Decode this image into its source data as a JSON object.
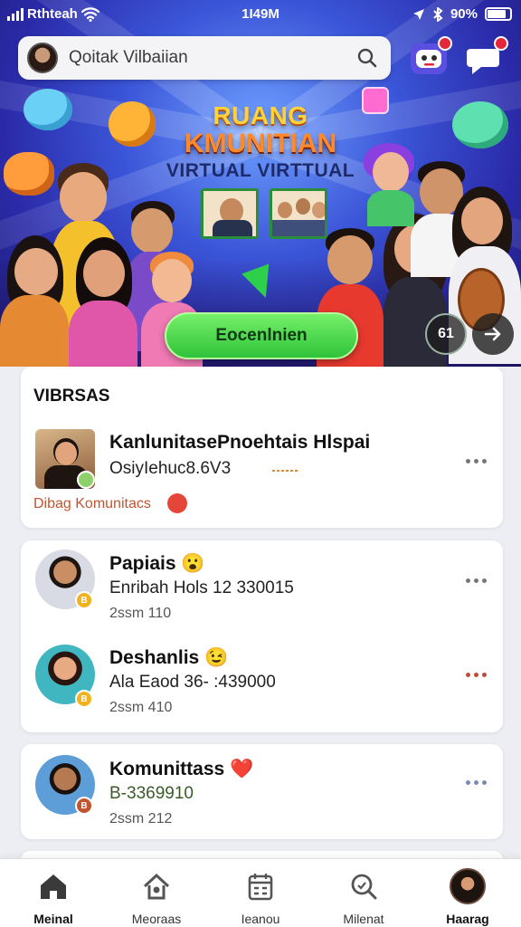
{
  "status_bar": {
    "carrier": "Rthteah",
    "time": "1I49M",
    "battery": "90%"
  },
  "header": {
    "search": {
      "value": "Qoitak Vilbaiian",
      "icon": "search-icon"
    },
    "chat_bot_icon": "chatbot-icon",
    "chat_icon": "chat-bubble-icon"
  },
  "hero": {
    "title_line1": "RUANG",
    "title_line2": "KMUNITIAN",
    "title_line3": "VIRTUAL VIRTTUAL",
    "cta_label": "Eocenlnien",
    "badge_label": "61",
    "arrow_icon": "arrow-right-icon"
  },
  "feed": {
    "section_title": "VIBRSAS",
    "featured": {
      "name": "KanlunitasePnoehtais Hlspai",
      "subtitle": "OsiyIehuc8.6V3",
      "tag": "Dibag Komunitacs"
    },
    "people": [
      {
        "name": "Papiais",
        "emoji": "😮",
        "line2": "Enribah Hols 12 330015",
        "line3": "2ssm 110",
        "badge": "B"
      },
      {
        "name": "Deshanlis",
        "emoji": "😉",
        "line2": "Ala Eaod 36- :439000",
        "line3": "2ssm 410",
        "badge": "B"
      },
      {
        "name": "Komunittass",
        "emoji": "❤️",
        "line2": "B-3369910",
        "line3": "2ssm 212",
        "badge": "B"
      }
    ]
  },
  "bottom_nav": [
    {
      "label": "Meinal",
      "icon": "home-icon"
    },
    {
      "label": "Meoraas",
      "icon": "community-icon"
    },
    {
      "label": "Ieanou",
      "icon": "calendar-icon"
    },
    {
      "label": "Milenat",
      "icon": "search-icon"
    },
    {
      "label": "Haarag",
      "icon": "profile-avatar"
    }
  ],
  "colors": {
    "hero_bg": "#3b55d8",
    "cta_green": "#2fc33a",
    "badge_red": "#e5263a",
    "title_yellow": "#ffd13a",
    "title_orange": "#ff8a2c"
  }
}
